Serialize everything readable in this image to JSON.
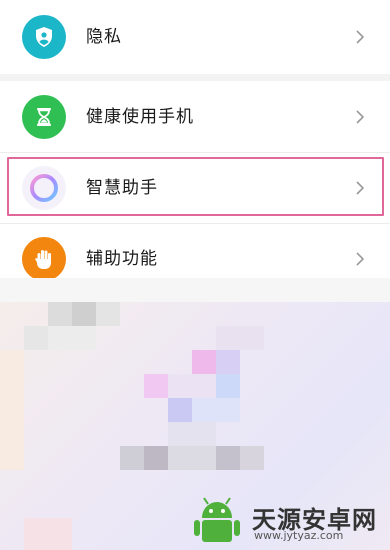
{
  "settings": {
    "items": [
      {
        "label": "隐私",
        "icon": "privacy-shield-icon",
        "color": "#1cb6c9"
      },
      {
        "label": "健康使用手机",
        "icon": "hourglass-icon",
        "color": "#2fbf52"
      },
      {
        "label": "智慧助手",
        "icon": "ring-icon",
        "color": "#b7a4f2"
      },
      {
        "label": "辅助功能",
        "icon": "hand-icon",
        "color": "#f2860f"
      }
    ],
    "chevron_icon": "chevron-right-icon",
    "highlight_color": "#e0679a"
  },
  "watermark": {
    "title": "天源安卓网",
    "url": "www.jytyaz.com",
    "logo_color": "#4fb13c"
  }
}
